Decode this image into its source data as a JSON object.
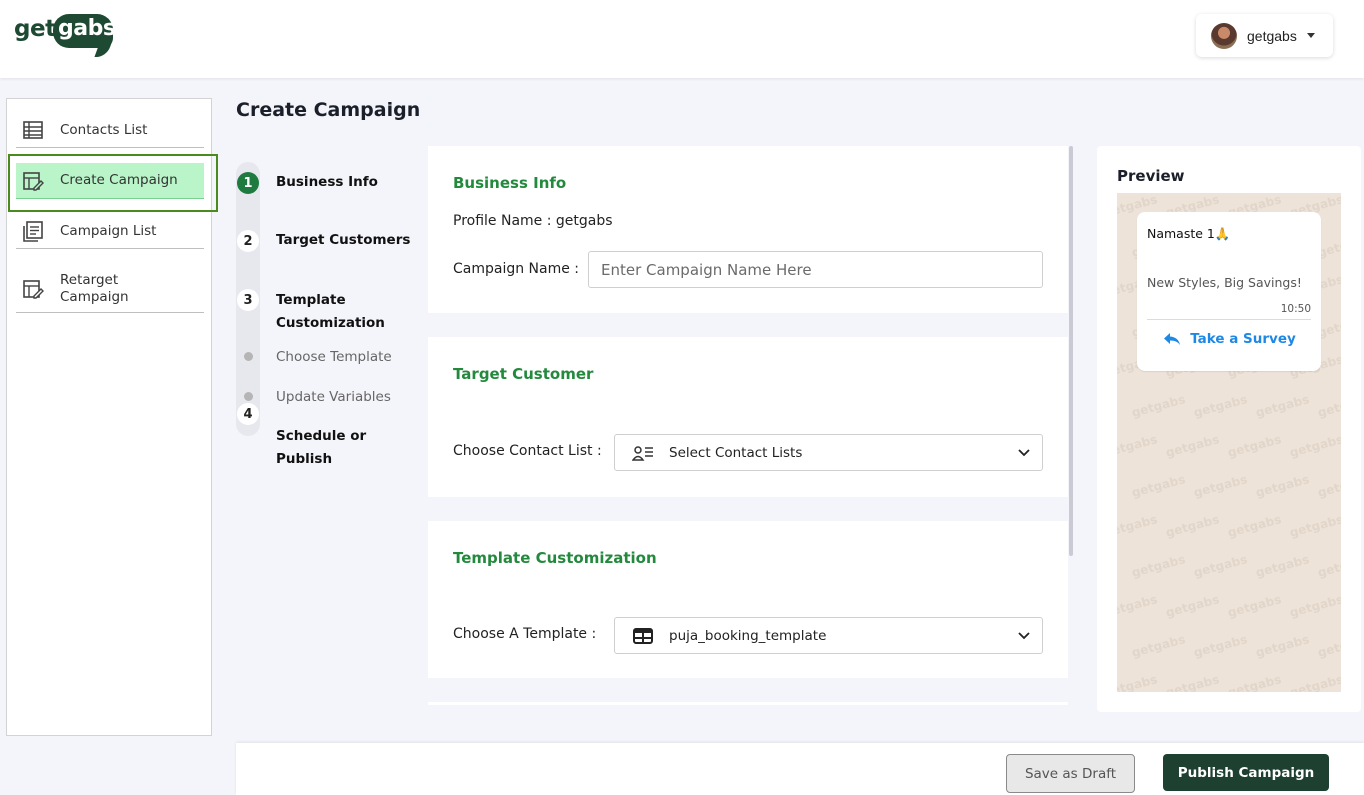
{
  "header": {
    "logo_get": "get",
    "logo_gabs": "gabs",
    "user_name": "getgabs"
  },
  "sidebar": {
    "items": [
      {
        "label": "Contacts List",
        "icon": "table-list-icon",
        "active": false
      },
      {
        "label": "Create Campaign",
        "icon": "edit-campaign-icon",
        "active": true
      },
      {
        "label": "Campaign List",
        "icon": "campaign-list-icon",
        "active": false
      },
      {
        "label": "Retarget Campaign",
        "icon": "retarget-campaign-icon",
        "active": false
      }
    ]
  },
  "page": {
    "title": "Create Campaign"
  },
  "stepper": {
    "steps": [
      {
        "number": "1",
        "label": "Business Info",
        "status": "done"
      },
      {
        "number": "2",
        "label": "Target Customers",
        "status": "todo"
      },
      {
        "number": "3",
        "label": "Template Customization",
        "status": "todo"
      },
      {
        "number": "4",
        "label": "Schedule or Publish",
        "status": "todo"
      }
    ],
    "substeps": [
      {
        "label": "Choose Template"
      },
      {
        "label": "Update Variables"
      }
    ]
  },
  "business_info": {
    "title": "Business Info",
    "profile_name": "Profile Name : getgabs",
    "campaign_name_label": "Campaign Name :",
    "campaign_name_placeholder": "Enter Campaign Name Here",
    "campaign_name_value": ""
  },
  "target_customer": {
    "title": "Target Customer",
    "contact_list_label": "Choose Contact List :",
    "contact_list_value": "Select Contact Lists"
  },
  "template_customization": {
    "title": "Template Customization",
    "template_label": "Choose A Template :",
    "template_value": "puja_booking_template"
  },
  "preview": {
    "title": "Preview",
    "watermark": "getgabs",
    "message": {
      "header": "Namaste 1🙏",
      "body": "New Styles, Big Savings!",
      "time": "10:50",
      "button_label": "Take a Survey"
    }
  },
  "footer": {
    "save_draft_label": "Save as Draft",
    "publish_label": "Publish Campaign"
  },
  "colors": {
    "brand_dark": "#1e4031",
    "accent_green": "#23893d",
    "active_bg": "#b9f5c8",
    "link_blue": "#1e88e5"
  }
}
